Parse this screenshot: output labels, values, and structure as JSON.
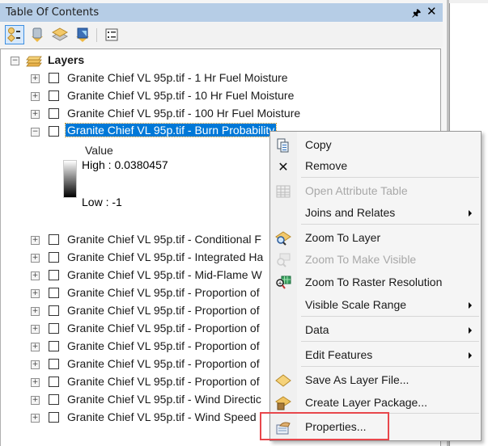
{
  "panel": {
    "title": "Table Of Contents",
    "pin_icon": "pin-icon",
    "close_icon": "close-icon"
  },
  "toolbar": {
    "buttons": [
      {
        "name": "list-by-drawing-order",
        "icon": "drawing-order-icon",
        "active": true
      },
      {
        "name": "list-by-source",
        "icon": "source-icon",
        "active": false
      },
      {
        "name": "list-by-visibility",
        "icon": "visibility-icon",
        "active": false
      },
      {
        "name": "list-by-selection",
        "icon": "selection-icon",
        "active": false
      },
      {
        "name": "options",
        "icon": "options-icon",
        "active": false
      }
    ]
  },
  "tree": {
    "root_label": "Layers",
    "layers": [
      {
        "label": "Granite Chief VL 95p.tif - 1 Hr Fuel Moisture",
        "expanded": false,
        "checked": false
      },
      {
        "label": "Granite Chief VL 95p.tif - 10 Hr Fuel Moisture",
        "expanded": false,
        "checked": false
      },
      {
        "label": "Granite Chief VL 95p.tif - 100 Hr Fuel Moisture",
        "expanded": false,
        "checked": false
      },
      {
        "label": "Granite Chief VL 95p.tif - Burn Probability",
        "expanded": true,
        "checked": false,
        "selected": true
      },
      {
        "label": "Granite Chief VL 95p.tif - Conditional F",
        "expanded": false,
        "checked": false
      },
      {
        "label": "Granite Chief VL 95p.tif - Integrated Ha",
        "expanded": false,
        "checked": false
      },
      {
        "label": "Granite Chief VL 95p.tif - Mid-Flame W",
        "expanded": false,
        "checked": false
      },
      {
        "label": "Granite Chief VL 95p.tif - Proportion of",
        "expanded": false,
        "checked": false
      },
      {
        "label": "Granite Chief VL 95p.tif - Proportion of",
        "expanded": false,
        "checked": false
      },
      {
        "label": "Granite Chief VL 95p.tif - Proportion of",
        "expanded": false,
        "checked": false
      },
      {
        "label": "Granite Chief VL 95p.tif - Proportion of",
        "expanded": false,
        "checked": false
      },
      {
        "label": "Granite Chief VL 95p.tif - Proportion of",
        "expanded": false,
        "checked": false
      },
      {
        "label": "Granite Chief VL 95p.tif - Proportion of",
        "expanded": false,
        "checked": false
      },
      {
        "label": "Granite Chief VL 95p.tif - Wind Directic",
        "expanded": false,
        "checked": false
      },
      {
        "label": "Granite Chief VL 95p.tif - Wind Speed",
        "expanded": false,
        "checked": false
      }
    ],
    "legend": {
      "heading": "Value",
      "high": "High : 0.0380457",
      "low": "Low : -1"
    }
  },
  "context_menu": {
    "items": [
      {
        "label": "Copy",
        "icon": "copy-icon",
        "enabled": true,
        "submenu": false
      },
      {
        "label": "Remove",
        "icon": "remove-icon",
        "enabled": true,
        "submenu": false
      },
      {
        "label": "Open Attribute Table",
        "icon": "table-icon",
        "enabled": false,
        "submenu": false
      },
      {
        "label": "Joins and Relates",
        "icon": "",
        "enabled": true,
        "submenu": true
      },
      {
        "label": "Zoom To Layer",
        "icon": "zoom-to-layer-icon",
        "enabled": true,
        "submenu": false
      },
      {
        "label": "Zoom To Make Visible",
        "icon": "zoom-to-make-visible-icon",
        "enabled": false,
        "submenu": false
      },
      {
        "label": "Zoom To Raster Resolution",
        "icon": "zoom-raster-resolution-icon",
        "enabled": true,
        "submenu": false
      },
      {
        "label": "Visible Scale Range",
        "icon": "",
        "enabled": true,
        "submenu": true
      },
      {
        "label": "Data",
        "icon": "",
        "enabled": true,
        "submenu": true
      },
      {
        "label": "Edit Features",
        "icon": "",
        "enabled": true,
        "submenu": true
      },
      {
        "label": "Save As Layer File...",
        "icon": "layer-file-icon",
        "enabled": true,
        "submenu": false
      },
      {
        "label": "Create Layer Package...",
        "icon": "layer-package-icon",
        "enabled": true,
        "submenu": false
      },
      {
        "label": "Properties...",
        "icon": "properties-icon",
        "enabled": true,
        "submenu": false,
        "highlighted": true
      }
    ]
  },
  "colors": {
    "selection": "#0078d7",
    "titlebar": "#b6cde6",
    "highlight_box": "#e8474c"
  }
}
